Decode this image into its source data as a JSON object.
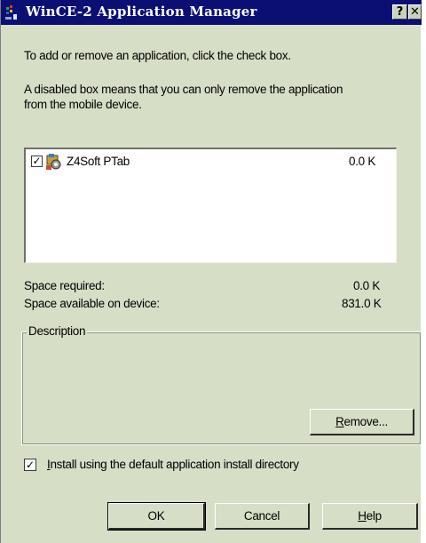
{
  "window": {
    "title": "WinCE-2 Application Manager",
    "help_button": "?",
    "close_button": "✕"
  },
  "instructions": {
    "line1": "To add or remove an application, click the check box.",
    "line2a": "A disabled box means that you can only remove the application",
    "line2b": "from the mobile device."
  },
  "app_list": {
    "items": [
      {
        "name": "Z4Soft PTab",
        "size": "0.0 K",
        "checked": true,
        "icon": "application-setup-icon"
      }
    ]
  },
  "space": {
    "required_label": "Space required:",
    "required_value": "0.0 K",
    "available_label": "Space available on device:",
    "available_value": "831.0 K"
  },
  "description": {
    "legend": "Description",
    "remove_button_pre": "",
    "remove_button_ul": "R",
    "remove_button_post": "emove..."
  },
  "install_option": {
    "checked": true,
    "label_ul": "I",
    "label_rest": "nstall using the default application install directory"
  },
  "buttons": {
    "ok": "OK",
    "cancel": "Cancel",
    "help_ul": "H",
    "help_rest": "elp"
  },
  "colors": {
    "titlebar": "#0b0f74",
    "dialog_face": "#d6dec6"
  }
}
